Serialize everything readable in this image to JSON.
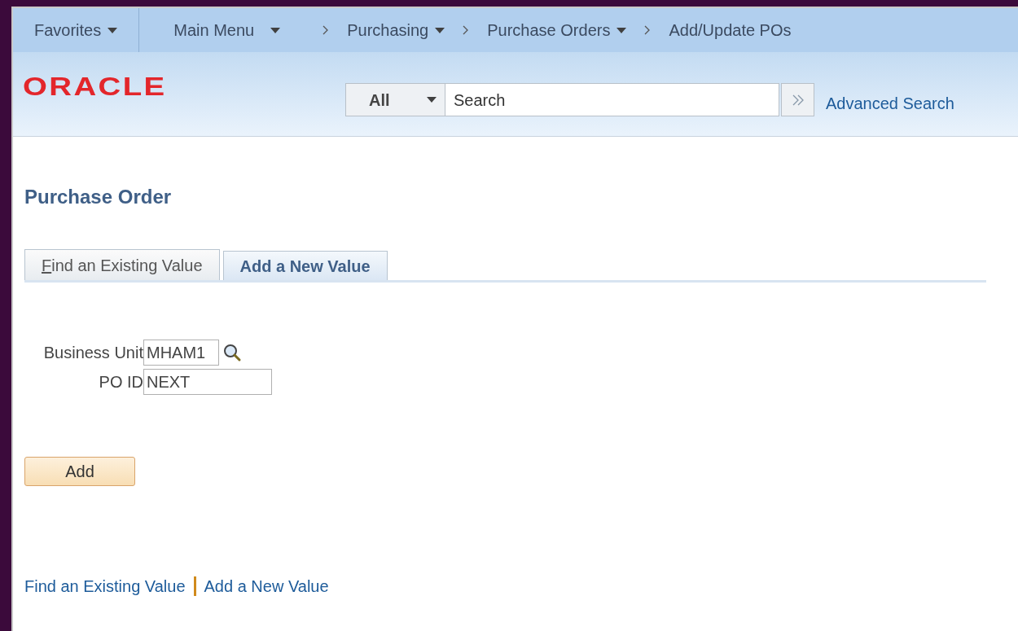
{
  "nav": {
    "favorites": "Favorites",
    "items": [
      {
        "label": "Main Menu",
        "dropdown": true
      },
      {
        "label": "Purchasing",
        "dropdown": true
      },
      {
        "label": "Purchase Orders",
        "dropdown": true
      },
      {
        "label": "Add/Update POs",
        "dropdown": false
      }
    ]
  },
  "header": {
    "logo": "ORACLE",
    "search_scope": "All",
    "search_placeholder": "Search",
    "advanced_search": "Advanced Search"
  },
  "page_title": "Purchase Order",
  "tabs": [
    {
      "label": "Find an Existing Value",
      "selected": false,
      "underline_first": true
    },
    {
      "label": "Add a New Value",
      "selected": true,
      "underline_first": false
    }
  ],
  "fields": [
    {
      "label": "Business Unit",
      "value": "MHAM1",
      "lookup": true
    },
    {
      "label": "PO ID",
      "value": "NEXT",
      "lookup": false
    }
  ],
  "add_button": "Add",
  "footer_links": [
    "Find an Existing Value",
    "Add a New Value"
  ]
}
